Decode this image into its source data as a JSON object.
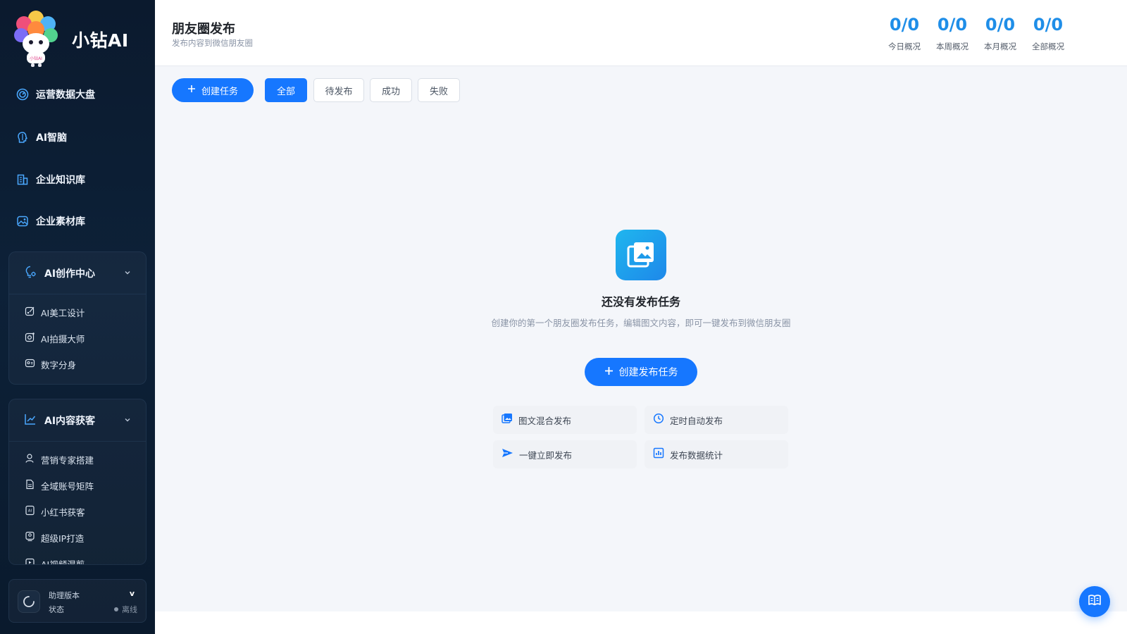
{
  "app": {
    "brand": "小钻AI",
    "logo_text": "小钻AI"
  },
  "sidebar": {
    "items": [
      {
        "label": "运营数据大盘",
        "icon": "dashboard-icon"
      },
      {
        "label": "AI智脑",
        "icon": "brain-icon"
      },
      {
        "label": "企业知识库",
        "icon": "building-icon"
      },
      {
        "label": "企业素材库",
        "icon": "image-library-icon"
      }
    ],
    "groups": [
      {
        "label": "AI创作中心",
        "icon": "bulb-gear-icon",
        "items": [
          {
            "label": "AI美工设计",
            "icon": "design-icon"
          },
          {
            "label": "AI拍摄大师",
            "icon": "camera-icon"
          },
          {
            "label": "数字分身",
            "icon": "avatar-card-icon"
          }
        ]
      },
      {
        "label": "AI内容获客",
        "icon": "trend-icon",
        "items": [
          {
            "label": "营销专家搭建",
            "icon": "user-icon"
          },
          {
            "label": "全域账号矩阵",
            "icon": "document-icon"
          },
          {
            "label": "小红书获客",
            "icon": "ai-box-icon"
          },
          {
            "label": "超级IP打造",
            "icon": "ip-icon"
          },
          {
            "label": "AI视频混剪",
            "icon": "video-icon"
          }
        ]
      }
    ],
    "assistant": {
      "title": "助理版本",
      "version": "v",
      "status_label": "状态",
      "status_value": "离线"
    }
  },
  "header": {
    "title": "朋友圈发布",
    "subtitle": "发布内容到微信朋友圈",
    "stats": [
      {
        "value": "0/0",
        "label": "今日概况"
      },
      {
        "value": "0/0",
        "label": "本周概况"
      },
      {
        "value": "0/0",
        "label": "本月概况"
      },
      {
        "value": "0/0",
        "label": "全部概况"
      }
    ]
  },
  "toolbar": {
    "create_label": "创建任务",
    "filters": [
      "全部",
      "待发布",
      "成功",
      "失败"
    ],
    "active_filter": "全部"
  },
  "empty_state": {
    "icon": "gallery-icon",
    "title": "还没有发布任务",
    "description": "创建你的第一个朋友圈发布任务，编辑图文内容，即可一键发布到微信朋友圈",
    "button_label": "创建发布任务",
    "features": [
      {
        "label": "图文混合发布",
        "icon": "image-icon"
      },
      {
        "label": "定时自动发布",
        "icon": "clock-icon"
      },
      {
        "label": "一键立即发布",
        "icon": "send-icon"
      },
      {
        "label": "发布数据统计",
        "icon": "bar-chart-icon"
      }
    ]
  },
  "colors": {
    "accent": "#1677ff",
    "stat_blue": "#1f8ee8",
    "sidebar_bg": "#0b1a2e"
  }
}
